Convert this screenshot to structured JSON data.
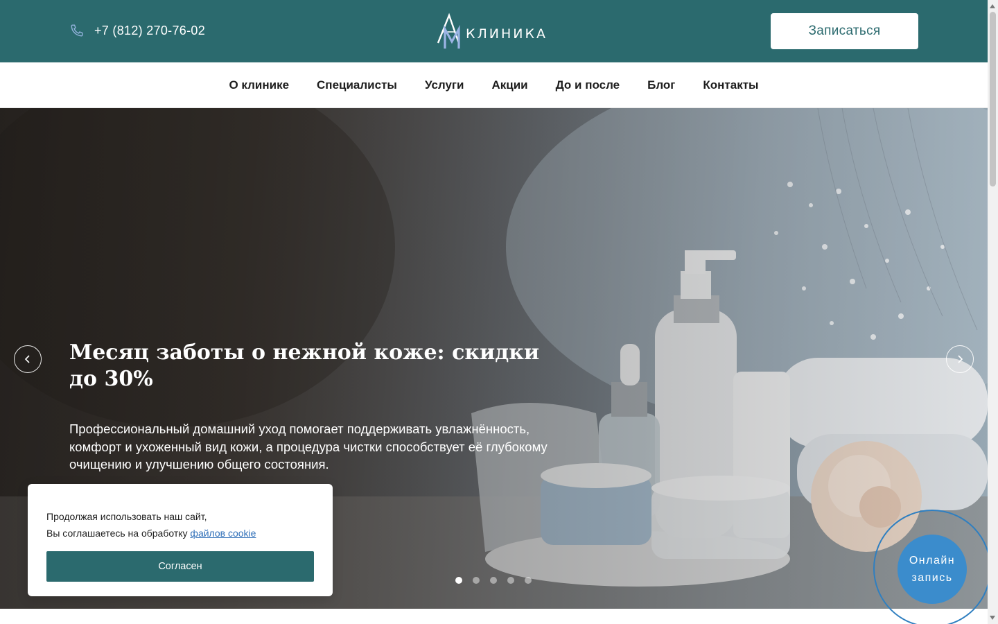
{
  "header": {
    "phone": "+7 (812) 270-76-02",
    "logo_text": "КЛИНИКА",
    "logo_mark": "AM",
    "cta_label": "Записаться",
    "phone_icon": "phone-icon"
  },
  "nav": {
    "items": [
      {
        "label": "О клинике"
      },
      {
        "label": "Специалисты"
      },
      {
        "label": "Услуги"
      },
      {
        "label": "Акции"
      },
      {
        "label": "До и после"
      },
      {
        "label": "Блог"
      },
      {
        "label": "Контакты"
      }
    ]
  },
  "hero": {
    "title": "Месяц заботы о нежной коже: скидки до 30%",
    "text": "Профессиональный домашний уход помогает поддерживать увлажнённость, комфорт и ухоженный вид кожи, а процедура чистки способствует её глубокому очищению и улучшению общего состояния.",
    "prev_icon": "chevron-left-icon",
    "next_icon": "chevron-right-icon",
    "slides_total": 5,
    "active_slide": 1
  },
  "cookie": {
    "line1": "Продолжая использовать наш сайт,",
    "line2_prefix": "Вы соглашаетесь на обработку ",
    "link": "файлов cookie",
    "button": "Согласен"
  },
  "online_booking": {
    "line1": "Онлайн",
    "line2": "запись"
  },
  "colors": {
    "brand_teal": "#2b6a6e",
    "widget_blue": "#3b8ccc",
    "link_blue": "#2f6fb8"
  }
}
